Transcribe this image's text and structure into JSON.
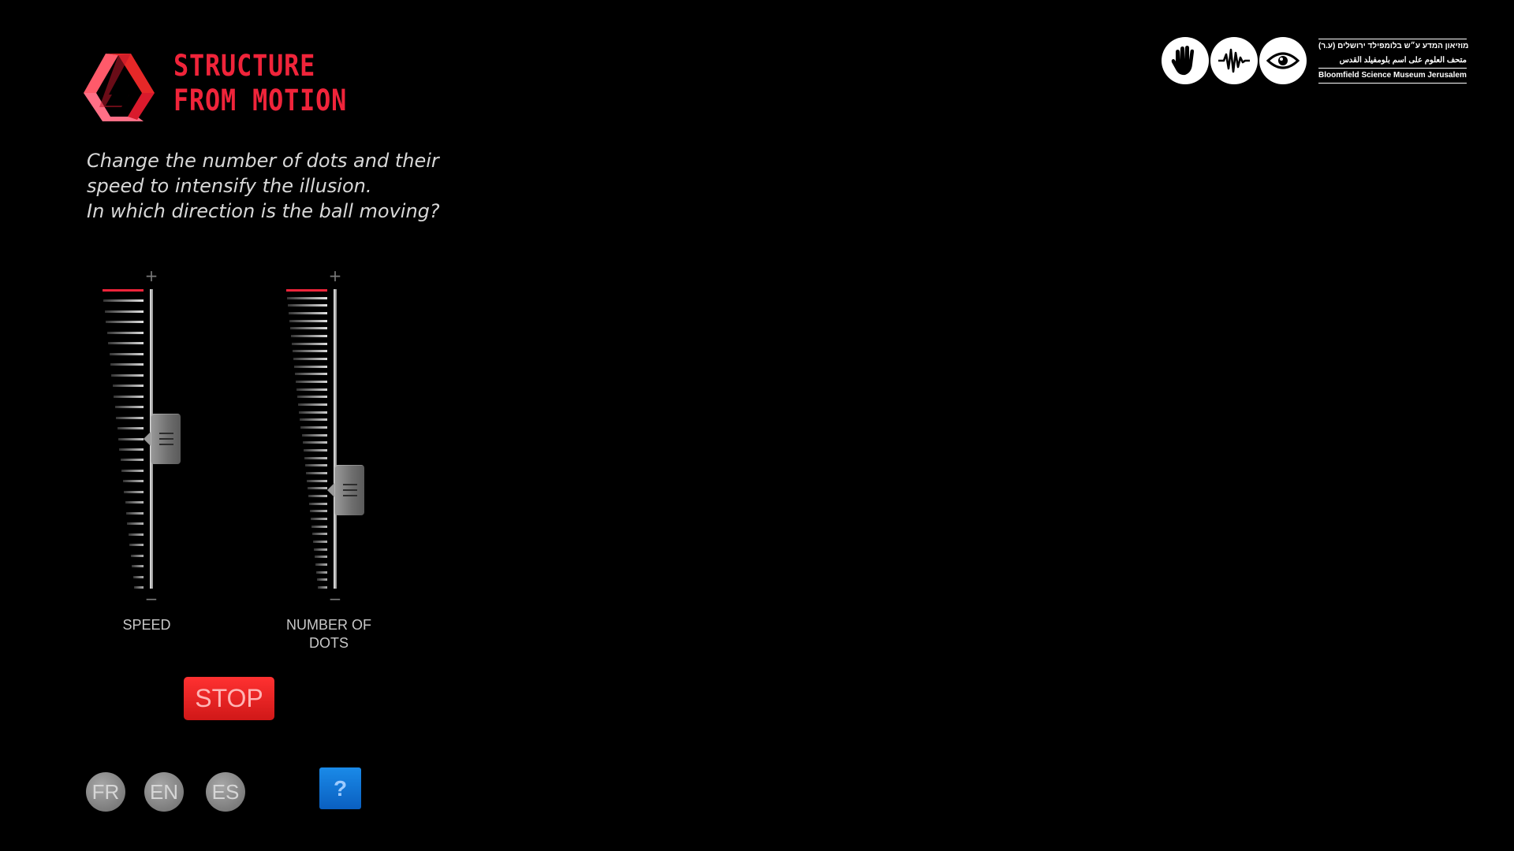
{
  "app": {
    "title_line1": "STRUCTURE",
    "title_line2": "FROM MOTION",
    "logo_icon": "impossible-triangle-icon",
    "accent_color": "#f0243a"
  },
  "instructions": {
    "line1": "Change the number of dots and their",
    "line2": "speed to intensify the illusion.",
    "line3": "In which direction is the ball moving?"
  },
  "sliders": [
    {
      "id": "speed",
      "label_line1": "SPEED",
      "label_line2": "",
      "plus": "+",
      "minus": "−",
      "level": 0.5
    },
    {
      "id": "dots",
      "label_line1": "NUMBER OF",
      "label_line2": "DOTS",
      "plus": "+",
      "minus": "−",
      "level": 0.33
    }
  ],
  "controls": {
    "stop_label": "STOP",
    "help_label": "?",
    "stop_color": "#e52222",
    "help_color": "#137ad8"
  },
  "languages": [
    "FR",
    "EN",
    "ES"
  ],
  "museum": {
    "icons": [
      "hand-icon",
      "sound-wave-icon",
      "eye-icon"
    ],
    "hebrew": "מוזיאון המדע ע״ש בלומפילד ירושלים (ע.ר)",
    "arabic": "متحف العلوم على اسم بلومفيلد القدس",
    "english": "Bloomfield Science Museum Jerusalem"
  }
}
